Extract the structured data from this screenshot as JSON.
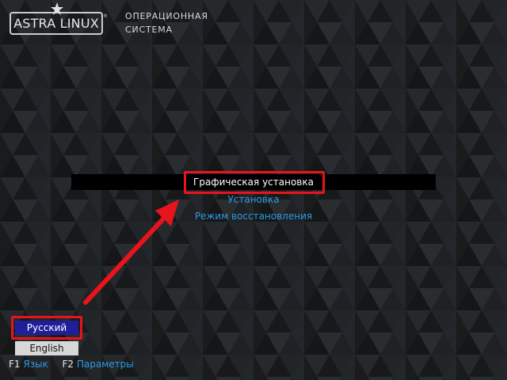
{
  "brand": {
    "logo_text": "ASTRA LINUX",
    "logo_tm": "®",
    "subtitle_line1": "ОПЕРАЦИОННАЯ",
    "subtitle_line2": "СИСТЕМА"
  },
  "boot_menu": {
    "items": [
      {
        "label": "Графическая установка",
        "selected": true
      },
      {
        "label": "Установка",
        "selected": false
      },
      {
        "label": "Режим восстановления",
        "selected": false
      }
    ]
  },
  "language": {
    "options": [
      {
        "label": "Русский",
        "selected": true
      },
      {
        "label": "English",
        "selected": false
      }
    ]
  },
  "footer": {
    "f1_key": "F1",
    "f1_label": "Язык",
    "f2_key": "F2",
    "f2_label": "Параметры"
  },
  "colors": {
    "background": "#1b1d1f",
    "menu_text": "#2d9be6",
    "selected_text": "#ffffff",
    "language_selected_bg": "#1f1f9a",
    "annotation_red": "#e8141c"
  }
}
